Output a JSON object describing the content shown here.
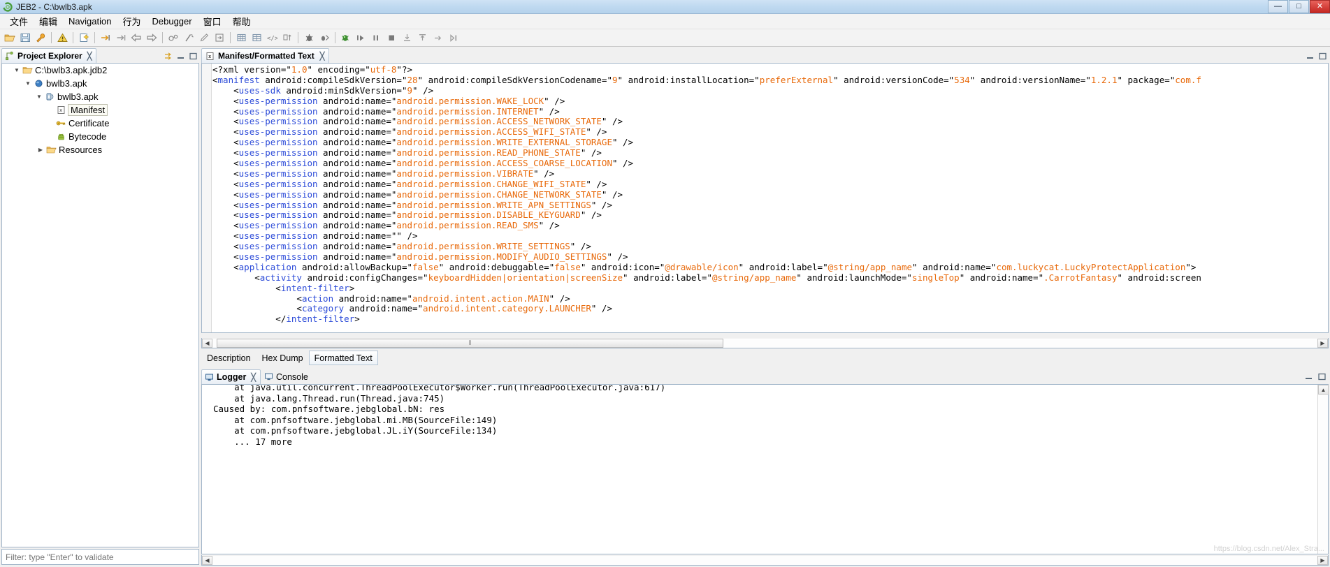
{
  "window": {
    "title": "JEB2 - C:\\bwlb3.apk",
    "logo_icon": "jeb-logo-icon",
    "buttons": [
      {
        "name": "minimize-button",
        "glyph": "—"
      },
      {
        "name": "maximize-button",
        "glyph": "□"
      },
      {
        "name": "close-button",
        "glyph": "✕"
      }
    ]
  },
  "menubar": {
    "items": [
      {
        "label": "文件",
        "name": "menu-file"
      },
      {
        "label": "编辑",
        "name": "menu-edit"
      },
      {
        "label": "Navigation",
        "name": "menu-navigation"
      },
      {
        "label": "行为",
        "name": "menu-action"
      },
      {
        "label": "Debugger",
        "name": "menu-debugger"
      },
      {
        "label": "窗口",
        "name": "menu-window"
      },
      {
        "label": "帮助",
        "name": "menu-help"
      }
    ]
  },
  "toolbar": {
    "buttons": [
      "open-folder-icon",
      "save-icon",
      "wrench-icon",
      "sep",
      "warning-icon",
      "sep",
      "new-document-icon",
      "sep",
      "goto-address-icon",
      "jump-forward-icon",
      "back-arrow-icon",
      "forward-arrow-icon",
      "sep",
      "decompile-icon",
      "comment-icon",
      "rename-icon",
      "export-icon",
      "sep",
      "table-view-icon",
      "grid-view-icon",
      "code-view-icon",
      "sort-icon",
      "sep",
      "bug-icon",
      "breakpoint-icon",
      "sep",
      "debug-start-icon",
      "step-over-icon",
      "pause-icon",
      "stop-icon",
      "step-into-icon",
      "step-out-icon",
      "step-return-icon",
      "run-to-icon"
    ]
  },
  "project_explorer": {
    "tab_label": "Project Explorer",
    "tab_icon": "project-explorer-icon",
    "close_glyph": "╳",
    "controls": [
      "link-editor-icon",
      "minimize-panel-icon",
      "maximize-panel-icon"
    ],
    "tree": [
      {
        "label": "C:\\bwlb3.apk.jdb2",
        "icon": "folder-icon",
        "depth": 0,
        "twisty": "expanded",
        "selected": false
      },
      {
        "label": "bwlb3.apk",
        "icon": "blue-sphere-icon",
        "depth": 1,
        "twisty": "expanded",
        "selected": false
      },
      {
        "label": "bwlb3.apk",
        "icon": "apk-unit-icon",
        "depth": 2,
        "twisty": "expanded",
        "selected": false
      },
      {
        "label": "Manifest",
        "icon": "xml-manifest-icon",
        "depth": 3,
        "twisty": "none",
        "selected": true
      },
      {
        "label": "Certificate",
        "icon": "key-icon",
        "depth": 3,
        "twisty": "none",
        "selected": false
      },
      {
        "label": "Bytecode",
        "icon": "android-icon",
        "depth": 3,
        "twisty": "none",
        "selected": false
      },
      {
        "label": "Resources",
        "icon": "resources-folder-icon",
        "depth": 3,
        "twisty": "collapsed",
        "selected": false
      }
    ],
    "filter": {
      "name": "filter-input",
      "placeholder": "Filter: type \"Enter\" to validate",
      "value": ""
    }
  },
  "editor": {
    "tab_label": "Manifest/Formatted Text",
    "tab_icon": "xml-manifest-icon",
    "close_glyph": "╳",
    "controls": [
      "minimize-editor-icon",
      "maximize-editor-icon"
    ],
    "view_tabs": [
      {
        "label": "Description",
        "active": false,
        "name": "tab-description"
      },
      {
        "label": "Hex Dump",
        "active": false,
        "name": "tab-hex-dump"
      },
      {
        "label": "Formatted Text",
        "active": true,
        "name": "tab-formatted-text"
      }
    ],
    "hscroll": {
      "left_glyph": "◀",
      "right_glyph": "▶",
      "thumb_glyph": "⦀"
    },
    "code_lines": [
      [
        [
          "plain",
          "<?xml version=\""
        ],
        [
          "str",
          "1.0"
        ],
        [
          "plain",
          "\" encoding=\""
        ],
        [
          "str",
          "utf-8"
        ],
        [
          "plain",
          "\"?>"
        ]
      ],
      [
        [
          "plain",
          "<"
        ],
        [
          "tagname",
          "manifest"
        ],
        [
          "plain",
          " android:compileSdkVersion=\""
        ],
        [
          "str",
          "28"
        ],
        [
          "plain",
          "\" android:compileSdkVersionCodename=\""
        ],
        [
          "str",
          "9"
        ],
        [
          "plain",
          "\" android:installLocation=\""
        ],
        [
          "str",
          "preferExternal"
        ],
        [
          "plain",
          "\" android:versionCode=\""
        ],
        [
          "str",
          "534"
        ],
        [
          "plain",
          "\" android:versionName=\""
        ],
        [
          "str",
          "1.2.1"
        ],
        [
          "plain",
          "\" package=\""
        ],
        [
          "str",
          "com.f"
        ]
      ],
      [
        [
          "plain",
          "    <"
        ],
        [
          "tagname",
          "uses-sdk"
        ],
        [
          "plain",
          " android:minSdkVersion=\""
        ],
        [
          "str",
          "9"
        ],
        [
          "plain",
          "\" />"
        ]
      ],
      [
        [
          "plain",
          "    <"
        ],
        [
          "tagname",
          "uses-permission"
        ],
        [
          "plain",
          " android:name=\""
        ],
        [
          "str",
          "android.permission.WAKE_LOCK"
        ],
        [
          "plain",
          "\" />"
        ]
      ],
      [
        [
          "plain",
          "    <"
        ],
        [
          "tagname",
          "uses-permission"
        ],
        [
          "plain",
          " android:name=\""
        ],
        [
          "str",
          "android.permission.INTERNET"
        ],
        [
          "plain",
          "\" />"
        ]
      ],
      [
        [
          "plain",
          "    <"
        ],
        [
          "tagname",
          "uses-permission"
        ],
        [
          "plain",
          " android:name=\""
        ],
        [
          "str",
          "android.permission.ACCESS_NETWORK_STATE"
        ],
        [
          "plain",
          "\" />"
        ]
      ],
      [
        [
          "plain",
          "    <"
        ],
        [
          "tagname",
          "uses-permission"
        ],
        [
          "plain",
          " android:name=\""
        ],
        [
          "str",
          "android.permission.ACCESS_WIFI_STATE"
        ],
        [
          "plain",
          "\" />"
        ]
      ],
      [
        [
          "plain",
          "    <"
        ],
        [
          "tagname",
          "uses-permission"
        ],
        [
          "plain",
          " android:name=\""
        ],
        [
          "str",
          "android.permission.WRITE_EXTERNAL_STORAGE"
        ],
        [
          "plain",
          "\" />"
        ]
      ],
      [
        [
          "plain",
          "    <"
        ],
        [
          "tagname",
          "uses-permission"
        ],
        [
          "plain",
          " android:name=\""
        ],
        [
          "str",
          "android.permission.READ_PHONE_STATE"
        ],
        [
          "plain",
          "\" />"
        ]
      ],
      [
        [
          "plain",
          "    <"
        ],
        [
          "tagname",
          "uses-permission"
        ],
        [
          "plain",
          " android:name=\""
        ],
        [
          "str",
          "android.permission.ACCESS_COARSE_LOCATION"
        ],
        [
          "plain",
          "\" />"
        ]
      ],
      [
        [
          "plain",
          "    <"
        ],
        [
          "tagname",
          "uses-permission"
        ],
        [
          "plain",
          " android:name=\""
        ],
        [
          "str",
          "android.permission.VIBRATE"
        ],
        [
          "plain",
          "\" />"
        ]
      ],
      [
        [
          "plain",
          "    <"
        ],
        [
          "tagname",
          "uses-permission"
        ],
        [
          "plain",
          " android:name=\""
        ],
        [
          "str",
          "android.permission.CHANGE_WIFI_STATE"
        ],
        [
          "plain",
          "\" />"
        ]
      ],
      [
        [
          "plain",
          "    <"
        ],
        [
          "tagname",
          "uses-permission"
        ],
        [
          "plain",
          " android:name=\""
        ],
        [
          "str",
          "android.permission.CHANGE_NETWORK_STATE"
        ],
        [
          "plain",
          "\" />"
        ]
      ],
      [
        [
          "plain",
          "    <"
        ],
        [
          "tagname",
          "uses-permission"
        ],
        [
          "plain",
          " android:name=\""
        ],
        [
          "str",
          "android.permission.WRITE_APN_SETTINGS"
        ],
        [
          "plain",
          "\" />"
        ]
      ],
      [
        [
          "plain",
          "    <"
        ],
        [
          "tagname",
          "uses-permission"
        ],
        [
          "plain",
          " android:name=\""
        ],
        [
          "str",
          "android.permission.DISABLE_KEYGUARD"
        ],
        [
          "plain",
          "\" />"
        ]
      ],
      [
        [
          "plain",
          "    <"
        ],
        [
          "tagname",
          "uses-permission"
        ],
        [
          "plain",
          " android:name=\""
        ],
        [
          "str",
          "android.permission.READ_SMS"
        ],
        [
          "plain",
          "\" />"
        ]
      ],
      [
        [
          "plain",
          "    <"
        ],
        [
          "tagname",
          "uses-permission"
        ],
        [
          "plain",
          " android:name=\"\" />"
        ]
      ],
      [
        [
          "plain",
          "    <"
        ],
        [
          "tagname",
          "uses-permission"
        ],
        [
          "plain",
          " android:name=\""
        ],
        [
          "str",
          "android.permission.WRITE_SETTINGS"
        ],
        [
          "plain",
          "\" />"
        ]
      ],
      [
        [
          "plain",
          "    <"
        ],
        [
          "tagname",
          "uses-permission"
        ],
        [
          "plain",
          " android:name=\""
        ],
        [
          "str",
          "android.permission.MODIFY_AUDIO_SETTINGS"
        ],
        [
          "plain",
          "\" />"
        ]
      ],
      [
        [
          "plain",
          "    <"
        ],
        [
          "tagname",
          "application"
        ],
        [
          "plain",
          " android:allowBackup=\""
        ],
        [
          "str",
          "false"
        ],
        [
          "plain",
          "\" android:debuggable=\""
        ],
        [
          "str",
          "false"
        ],
        [
          "plain",
          "\" android:icon=\""
        ],
        [
          "str",
          "@drawable/icon"
        ],
        [
          "plain",
          "\" android:label=\""
        ],
        [
          "str",
          "@string/app_name"
        ],
        [
          "plain",
          "\" android:name=\""
        ],
        [
          "str",
          "com.luckycat.LuckyProtectApplication"
        ],
        [
          "plain",
          "\">"
        ]
      ],
      [
        [
          "plain",
          "        <"
        ],
        [
          "tagname",
          "activity"
        ],
        [
          "plain",
          " android:configChanges=\""
        ],
        [
          "str",
          "keyboardHidden|orientation|screenSize"
        ],
        [
          "plain",
          "\" android:label=\""
        ],
        [
          "str",
          "@string/app_name"
        ],
        [
          "plain",
          "\" android:launchMode=\""
        ],
        [
          "str",
          "singleTop"
        ],
        [
          "plain",
          "\" android:name=\""
        ],
        [
          "str",
          ".CarrotFantasy"
        ],
        [
          "plain",
          "\" android:screen"
        ]
      ],
      [
        [
          "plain",
          "            <"
        ],
        [
          "tagname",
          "intent-filter"
        ],
        [
          "plain",
          ">"
        ]
      ],
      [
        [
          "plain",
          "                <"
        ],
        [
          "tagname",
          "action"
        ],
        [
          "plain",
          " android:name=\""
        ],
        [
          "str",
          "android.intent.action.MAIN"
        ],
        [
          "plain",
          "\" />"
        ]
      ],
      [
        [
          "plain",
          "                <"
        ],
        [
          "tagname",
          "category"
        ],
        [
          "plain",
          " android:name=\""
        ],
        [
          "str",
          "android.intent.category.LAUNCHER"
        ],
        [
          "plain",
          "\" />"
        ]
      ],
      [
        [
          "plain",
          "            </"
        ],
        [
          "tagname",
          "intent-filter"
        ],
        [
          "plain",
          ">"
        ]
      ]
    ]
  },
  "logger": {
    "tabs": [
      {
        "label": "Logger",
        "icon": "logger-icon",
        "active": true,
        "name": "tab-logger",
        "close_glyph": "╳"
      },
      {
        "label": "Console",
        "icon": "console-icon",
        "active": false,
        "name": "tab-console"
      }
    ],
    "controls": [
      "minimize-logger-icon",
      "maximize-logger-icon"
    ],
    "text": "    at java.util.concurrent.ThreadPoolExecutor$Worker.run(ThreadPoolExecutor.java:617)\n    at java.lang.Thread.run(Thread.java:745)\nCaused by: com.pnfsoftware.jebglobal.bN: res\n    at com.pnfsoftware.jebglobal.mi.MB(SourceFile:149)\n    at com.pnfsoftware.jebglobal.JL.iY(SourceFile:134)\n    ... 17 more"
  },
  "watermark": "https://blog.csdn.net/Alex_Stra...",
  "colors": {
    "accent": "#b5d2ec",
    "string": "#e8690a",
    "tag": "#2b4ad8",
    "panel_border": "#a0b4c8"
  }
}
